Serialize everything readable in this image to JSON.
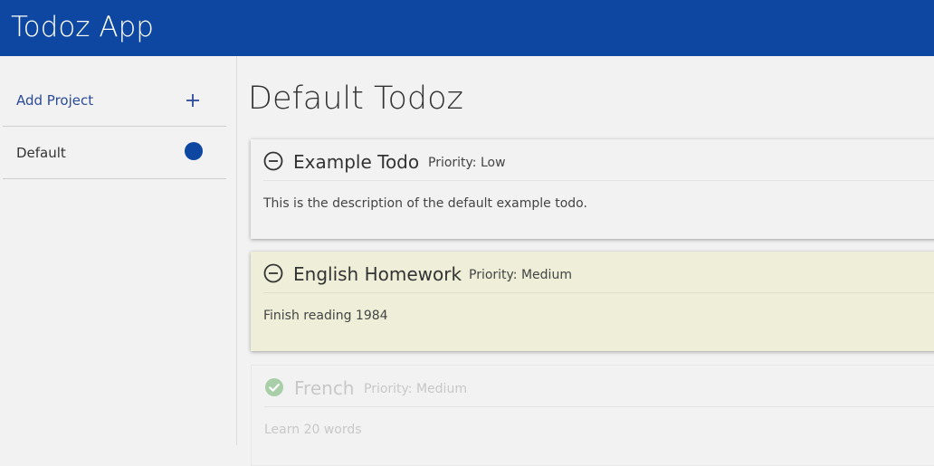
{
  "app": {
    "title": "Todoz App"
  },
  "colors": {
    "header": "#0d47a1",
    "project_dot": "#0d47a1",
    "medium_priority_bg": "#efefd9",
    "done_check": "#a9cfa9"
  },
  "sidebar": {
    "add_project": {
      "label": "Add Project",
      "icon": "plus-icon"
    },
    "projects": [
      {
        "label": "Default",
        "icon": "project-color-dot"
      }
    ]
  },
  "main": {
    "title": "Default Todoz",
    "todos": [
      {
        "name": "Example Todo",
        "priority": "Priority: Low",
        "description": "This is the description of the default example todo.",
        "status_icon": "minus-circle-icon",
        "completed": false
      },
      {
        "name": "English Homework",
        "priority": "Priority: Medium",
        "description": "Finish reading 1984",
        "status_icon": "minus-circle-icon",
        "completed": false
      },
      {
        "name": "French",
        "priority": "Priority: Medium",
        "description": "Learn 20 words",
        "status_icon": "check-circle-icon",
        "completed": true
      }
    ]
  }
}
